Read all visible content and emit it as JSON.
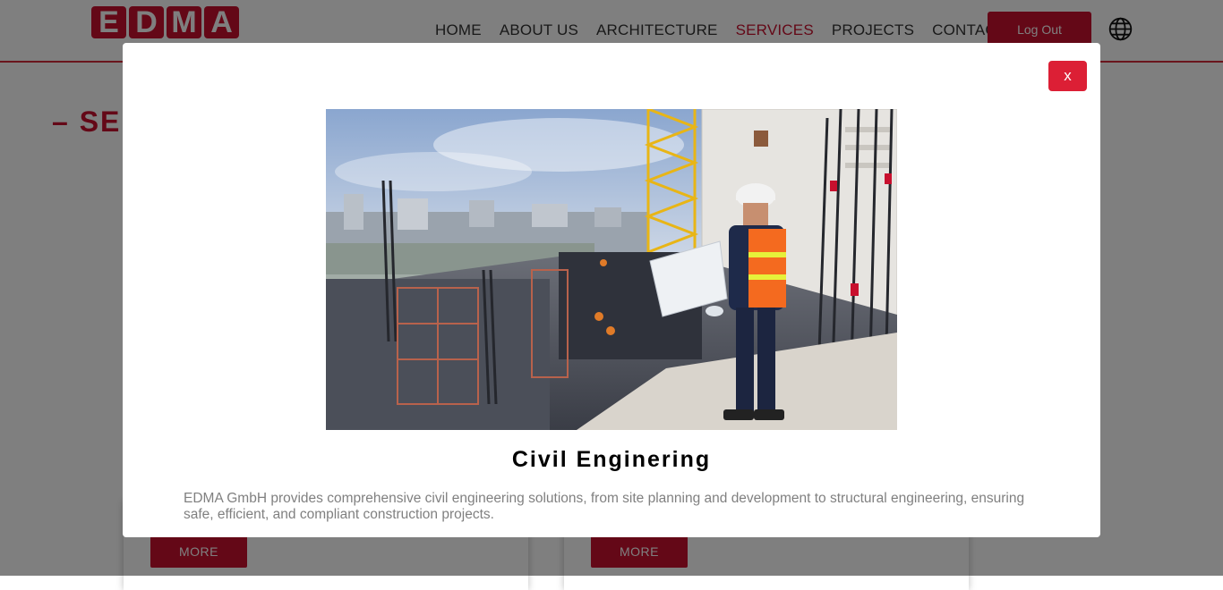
{
  "header": {
    "logo_letters": [
      "E",
      "D",
      "M",
      "A"
    ],
    "nav": [
      {
        "label": "HOME"
      },
      {
        "label": "ABOUT US"
      },
      {
        "label": "ARCHITECTURE"
      },
      {
        "label": "SERVICES",
        "active": true
      },
      {
        "label": "PROJECTS"
      },
      {
        "label": "CONTACT"
      }
    ],
    "logout_label": "Log Out",
    "language_icon": "globe-icon"
  },
  "page": {
    "section_title": "– SE",
    "cards": [
      {
        "more_label": "MORE"
      },
      {
        "more_label": "MORE"
      }
    ]
  },
  "modal": {
    "close_label": "x",
    "title": "Civil Enginering",
    "description": "EDMA GmbH provides comprehensive civil engineering solutions, from site planning and development to structural engineering, ensuring safe, efficient, and compliant construction projects."
  },
  "colors": {
    "brand": "#c8102e",
    "close_button": "#dc1f35",
    "overlay": "rgba(0,0,0,0.5)"
  }
}
